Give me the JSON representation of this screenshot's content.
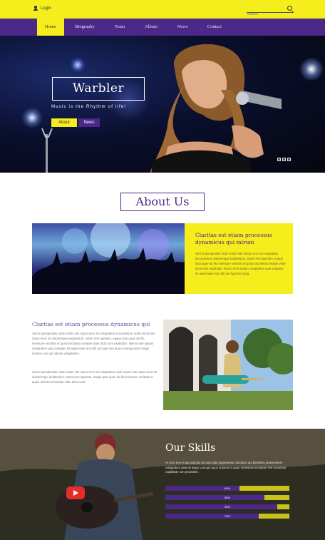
{
  "topbar": {
    "login_label": "Login",
    "search_placeholder": "Search"
  },
  "nav": {
    "items": [
      "Home",
      "Biography",
      "Team",
      "Album",
      "News",
      "Contact"
    ],
    "active": "Home"
  },
  "hero": {
    "title": "Warbler",
    "subtitle": "Music is the Rhythm of life!",
    "about_button": "About",
    "news_button": "News"
  },
  "about": {
    "title": "About Us",
    "panel_heading": "Claritas est etiam processus dynamicus qui mirum",
    "panel_text": "Sed ut perspiciatis unde omnis iste natus error sit voluptatem accusantium doloremque laudantium, totam rem aperiam, eaque ipsa quae ab illo inventore veritatis et quasi architecto beatae vitae dicta sunt explicabo. Nemo enim ipsam voluptatem quia voluptas sit aspernatur aut odit aut fugit sed quia.",
    "section_heading": "Claritas est etiam processus dynamicus qui",
    "paragraph_1": "Sed ut perspiciatis unde omnis iste natus error sit voluptatem accusantium unde omnis iste natus error sit doloremque laudantium, totam rem aperiam, eaque ipsa quae ab illo inventore veritatis et quasi architecto beatae vitae dicta sunt explicabo. Nemo enim ipsam voluptatem quia voluptas sit aspernatur aut odit aut fugit sed quia consequuntur magni dolores eos qui ratione voluptatem.",
    "paragraph_2": "Sed ut perspiciatis unde omnis iste natus error sit voluptatem unde omnis iste natus error sit doloremque laudantium, totam rem aperiam, eaque ipsa quae ab illo inventore veritatis et quasi architecto beatae vitae dicta sunt."
  },
  "skills": {
    "title": "Our Skills",
    "text": "At vero eos et accusamus et iusto odio dignissimos ducimus qui blanditiis praesentium voluptatum deleniti atque corrupti quos dolores et quas molestias excepturi sint occaecati cupiditate non provident.",
    "bars": [
      {
        "label": "60%",
        "value": 0.6
      },
      {
        "label": "80%",
        "value": 0.8
      },
      {
        "label": "90%",
        "value": 0.9
      },
      {
        "label": "75%",
        "value": 0.75
      }
    ]
  },
  "colors": {
    "accent_yellow": "#f5ee1c",
    "accent_purple": "#4c2889"
  },
  "icons": {
    "login": "user-icon",
    "search": "search-icon",
    "video": "play-icon"
  }
}
